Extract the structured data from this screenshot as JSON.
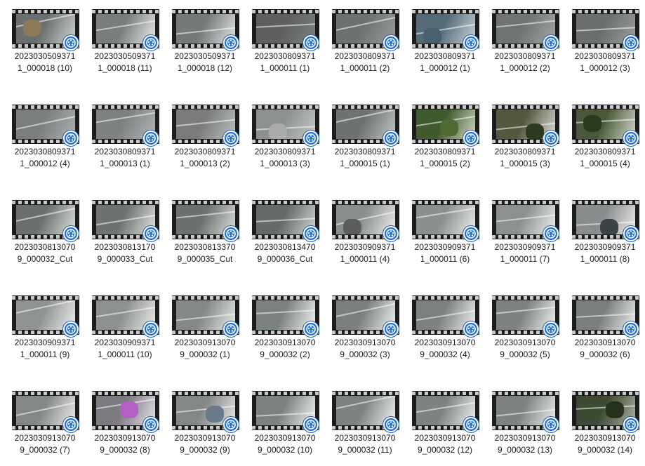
{
  "view": "file-explorer-large-icons",
  "file_type_icon": "video-player-badge-icon",
  "colors": {
    "badge": "#1f6fd6",
    "text": "#1a1a1a",
    "background": "#ffffff"
  },
  "files": [
    {
      "line1": "2023030509371",
      "line2": "1_000018 (10)",
      "bg": "#6b6e6f",
      "light": "#cfd3d2",
      "accent": "#8a7a5a"
    },
    {
      "line1": "2023030509371",
      "line2": "1_000018 (11)",
      "bg": "#7a7d7d",
      "light": "#e9eceb",
      "accent": ""
    },
    {
      "line1": "2023030509371",
      "line2": "1_000018 (12)",
      "bg": "#767979",
      "light": "#e3e6e5",
      "accent": ""
    },
    {
      "line1": "2023030809371",
      "line2": "1_000011 (1)",
      "bg": "#5d5f60",
      "light": "#7d8081",
      "accent": ""
    },
    {
      "line1": "2023030809371",
      "line2": "1_000011 (2)",
      "bg": "#6e7171",
      "light": "#9a9d9d",
      "accent": ""
    },
    {
      "line1": "2023030809371",
      "line2": "1_000012 (1)",
      "bg": "#556b78",
      "light": "#c9d3d8",
      "accent": "#49616f"
    },
    {
      "line1": "2023030809371",
      "line2": "1_000012 (2)",
      "bg": "#707373",
      "light": "#a3a6a6",
      "accent": ""
    },
    {
      "line1": "2023030809371",
      "line2": "1_000012 (3)",
      "bg": "#6b6e6e",
      "light": "#9b9e9e",
      "accent": ""
    },
    {
      "line1": "2023030809371",
      "line2": "1_000012 (4)",
      "bg": "#7b7e7e",
      "light": "#aeb1b1",
      "accent": ""
    },
    {
      "line1": "2023030809371",
      "line2": "1_000013 (1)",
      "bg": "#7e8181",
      "light": "#b1b4b4",
      "accent": ""
    },
    {
      "line1": "2023030809371",
      "line2": "1_000013 (2)",
      "bg": "#7a7c7c",
      "light": "#bcbfbf",
      "accent": ""
    },
    {
      "line1": "2023030809371",
      "line2": "1_000013 (3)",
      "bg": "#8d9090",
      "light": "#c3c6c6",
      "accent": "#a9acab"
    },
    {
      "line1": "2023030809371",
      "line2": "1_000015 (1)",
      "bg": "#6f7272",
      "light": "#c1c4c3",
      "accent": ""
    },
    {
      "line1": "2023030809371",
      "line2": "1_000015 (2)",
      "bg": "#3f5a2c",
      "light": "#cfd6c6",
      "accent": "#4e6b34"
    },
    {
      "line1": "2023030809371",
      "line2": "1_000015 (3)",
      "bg": "#54583f",
      "light": "#d9ddd8",
      "accent": "#2f3a22"
    },
    {
      "line1": "2023030809371",
      "line2": "1_000015 (4)",
      "bg": "#4a5838",
      "light": "#d3d8cf",
      "accent": "#2d3a1f"
    },
    {
      "line1": "2023030813070",
      "line2": "9_000032_Cut",
      "bg": "#6c706d",
      "light": "#dfe3df",
      "accent": ""
    },
    {
      "line1": "2023030813170",
      "line2": "9_000033_Cut",
      "bg": "#6f736f",
      "light": "#e2e5e2",
      "accent": ""
    },
    {
      "line1": "2023030813370",
      "line2": "9_000035_Cut",
      "bg": "#6d716e",
      "light": "#dde0dd",
      "accent": ""
    },
    {
      "line1": "2023030813470",
      "line2": "9_000036_Cut",
      "bg": "#666a67",
      "light": "#d2d6d2",
      "accent": ""
    },
    {
      "line1": "2023030909371",
      "line2": "1_000011 (4)",
      "bg": "#8a8e8e",
      "light": "#eef0ef",
      "accent": "#5b5d5e"
    },
    {
      "line1": "2023030909371",
      "line2": "1_000011 (6)",
      "bg": "#8b8f8f",
      "light": "#eef0ef",
      "accent": ""
    },
    {
      "line1": "2023030909371",
      "line2": "1_000011 (7)",
      "bg": "#8c9090",
      "light": "#eef0ef",
      "accent": ""
    },
    {
      "line1": "2023030909371",
      "line2": "1_000011 (8)",
      "bg": "#8a8d8d",
      "light": "#eceeed",
      "accent": "#3c4448"
    },
    {
      "line1": "2023030909371",
      "line2": "1_000011 (9)",
      "bg": "#8f9292",
      "light": "#eef0ef",
      "accent": ""
    },
    {
      "line1": "2023030909371",
      "line2": "1_000011 (10)",
      "bg": "#8d9090",
      "light": "#eceeed",
      "accent": ""
    },
    {
      "line1": "2023030913070",
      "line2": "9_000032 (1)",
      "bg": "#848888",
      "light": "#e8ebea",
      "accent": ""
    },
    {
      "line1": "2023030913070",
      "line2": "9_000032 (2)",
      "bg": "#7b8080",
      "light": "#f4f6f6",
      "accent": ""
    },
    {
      "line1": "2023030913070",
      "line2": "9_000032 (3)",
      "bg": "#7b7f7f",
      "light": "#f2f4f4",
      "accent": ""
    },
    {
      "line1": "2023030913070",
      "line2": "9_000032 (4)",
      "bg": "#7c8080",
      "light": "#f2f4f4",
      "accent": ""
    },
    {
      "line1": "2023030913070",
      "line2": "9_000032 (5)",
      "bg": "#7d8181",
      "light": "#f2f4f4",
      "accent": ""
    },
    {
      "line1": "2023030913070",
      "line2": "9_000032 (6)",
      "bg": "#7a7e7e",
      "light": "#eef1f1",
      "accent": ""
    },
    {
      "line1": "2023030913070",
      "line2": "9_000032 (7)",
      "bg": "#848787",
      "light": "#eceeed",
      "accent": ""
    },
    {
      "line1": "2023030913070",
      "line2": "9_000032 (8)",
      "bg": "#7e7a82",
      "light": "#e7e3ea",
      "accent": "#b45fc4"
    },
    {
      "line1": "2023030913070",
      "line2": "9_000032 (9)",
      "bg": "#848787",
      "light": "#e6e8e7",
      "accent": "#6a7a8a"
    },
    {
      "line1": "2023030913070",
      "line2": "9_000032 (10)",
      "bg": "#7d8181",
      "light": "#f3f5f5",
      "accent": ""
    },
    {
      "line1": "2023030913070",
      "line2": "9_000032 (11)",
      "bg": "#7d8181",
      "light": "#f3f5f5",
      "accent": ""
    },
    {
      "line1": "2023030913070",
      "line2": "9_000032 (12)",
      "bg": "#7e8282",
      "light": "#f1f3f3",
      "accent": ""
    },
    {
      "line1": "2023030913070",
      "line2": "9_000032 (13)",
      "bg": "#7e8282",
      "light": "#eff1f1",
      "accent": ""
    },
    {
      "line1": "2023030913070",
      "line2": "9_000032 (14)",
      "bg": "#3e4a33",
      "light": "#a9b0a2",
      "accent": "#26311c"
    }
  ]
}
